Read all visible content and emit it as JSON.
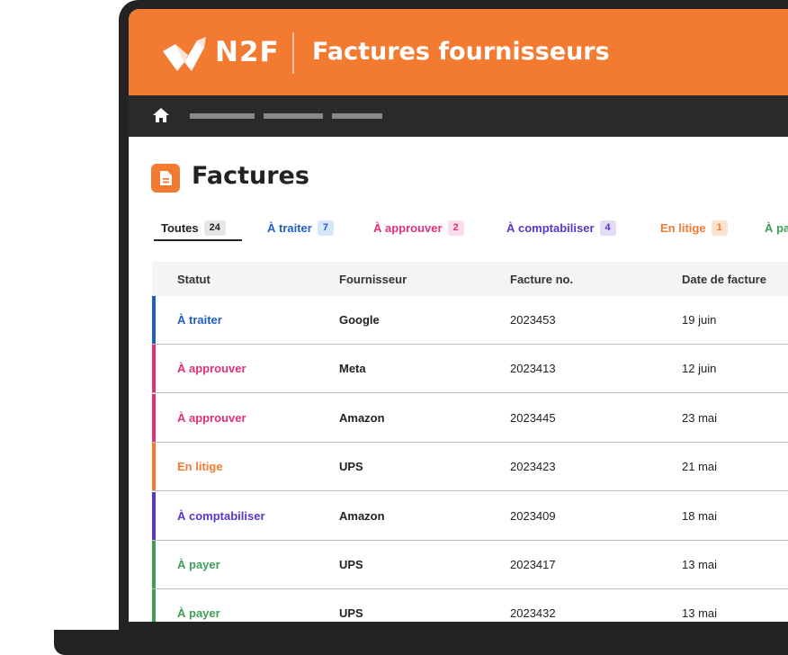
{
  "header": {
    "brand": "N2F",
    "title": "Factures fournisseurs",
    "color": "#f37a31"
  },
  "nav": {
    "home_icon": "home-icon"
  },
  "page": {
    "title": "Factures",
    "title_icon": "document-icon"
  },
  "tabs": [
    {
      "label": "Toutes",
      "count": "24",
      "color": "#222222",
      "badge_bg": "#e6e6e6"
    },
    {
      "label": "À traiter",
      "count": "7",
      "color": "#1f5fc4",
      "badge_bg": "#d6e7fb"
    },
    {
      "label": "À approuver",
      "count": "2",
      "color": "#e0307a",
      "badge_bg": "#fbdcea"
    },
    {
      "label": "À comptabiliser",
      "count": "4",
      "color": "#5b35c9",
      "badge_bg": "#e3dcf7"
    },
    {
      "label": "En litige",
      "count": "1",
      "color": "#f37a31",
      "badge_bg": "#fde2d0"
    },
    {
      "label": "À pa",
      "count": "",
      "color": "#3e9e58",
      "badge_bg": "transparent"
    }
  ],
  "table": {
    "columns": [
      "Statut",
      "Fournisseur",
      "Facture no.",
      "Date de facture"
    ],
    "rows": [
      {
        "status": "À traiter",
        "supplier": "Google",
        "invoice": "2023453",
        "date": "19 juin",
        "color": "#1f5fc4"
      },
      {
        "status": "À approuver",
        "supplier": "Meta",
        "invoice": "2023413",
        "date": "12 juin",
        "color": "#e0307a"
      },
      {
        "status": "À approuver",
        "supplier": "Amazon",
        "invoice": "2023445",
        "date": "23 mai",
        "color": "#e0307a"
      },
      {
        "status": "En litige",
        "supplier": "UPS",
        "invoice": "2023423",
        "date": "21 mai",
        "color": "#f37a31"
      },
      {
        "status": "À comptabiliser",
        "supplier": "Amazon",
        "invoice": "2023409",
        "date": "18 mai",
        "color": "#5b35c9"
      },
      {
        "status": "À payer",
        "supplier": "UPS",
        "invoice": "2023417",
        "date": "13 mai",
        "color": "#3e9e58"
      },
      {
        "status": "À payer",
        "supplier": "UPS",
        "invoice": "2023432",
        "date": "13 mai",
        "color": "#3e9e58"
      }
    ]
  }
}
